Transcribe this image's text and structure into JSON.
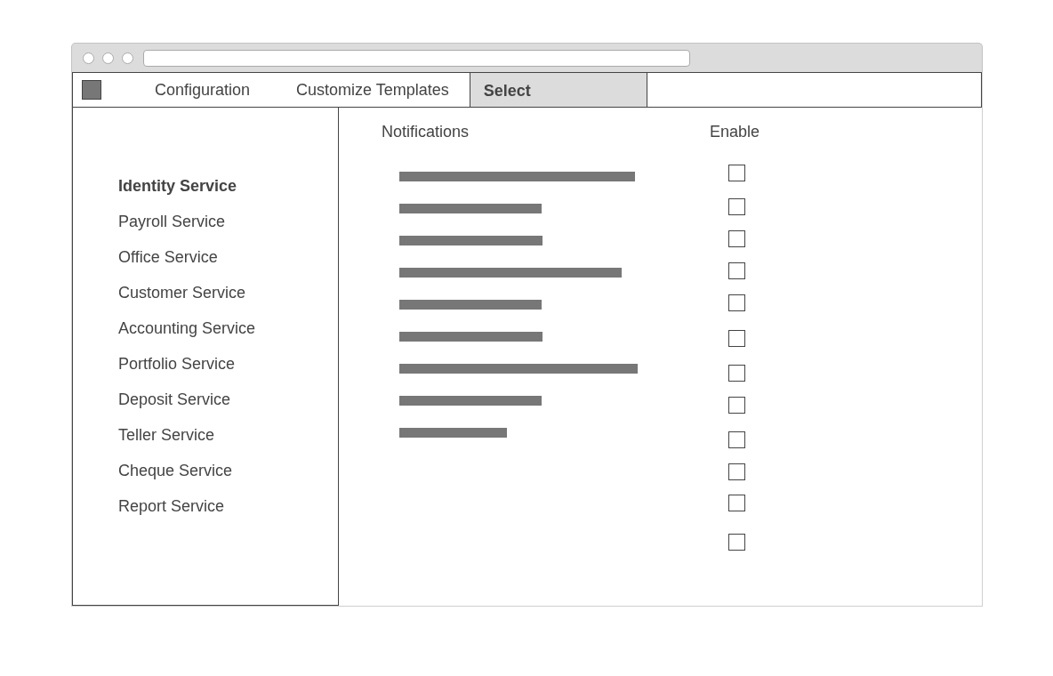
{
  "nav": {
    "tabs": [
      {
        "label": "Configuration",
        "selected": false
      },
      {
        "label": "Customize Templates",
        "selected": false
      },
      {
        "label": "Select",
        "selected": true
      }
    ]
  },
  "sidebar": {
    "items": [
      {
        "label": "Identity Service",
        "selected": true
      },
      {
        "label": "Payroll Service",
        "selected": false
      },
      {
        "label": "Office Service",
        "selected": false
      },
      {
        "label": "Customer Service",
        "selected": false
      },
      {
        "label": "Accounting Service",
        "selected": false
      },
      {
        "label": "Portfolio Service",
        "selected": false
      },
      {
        "label": "Deposit Service",
        "selected": false
      },
      {
        "label": "Teller Service",
        "selected": false
      },
      {
        "label": "Cheque Service",
        "selected": false
      },
      {
        "label": "Report Service",
        "selected": false
      }
    ]
  },
  "table": {
    "columns": [
      "Notifications",
      "Enable"
    ],
    "rows": [
      {
        "placeholder_line": true,
        "checked": false
      },
      {
        "placeholder_line": true,
        "checked": false
      },
      {
        "placeholder_line": true,
        "checked": false
      },
      {
        "placeholder_line": true,
        "checked": false
      },
      {
        "placeholder_line": true,
        "checked": false
      },
      {
        "placeholder_line": true,
        "checked": false
      },
      {
        "placeholder_line": true,
        "checked": false
      },
      {
        "placeholder_line": true,
        "checked": false
      },
      {
        "placeholder_line": true,
        "checked": false
      },
      {
        "placeholder_line": false,
        "checked": false
      },
      {
        "placeholder_line": false,
        "checked": false
      },
      {
        "placeholder_line": false,
        "checked": false
      }
    ]
  }
}
